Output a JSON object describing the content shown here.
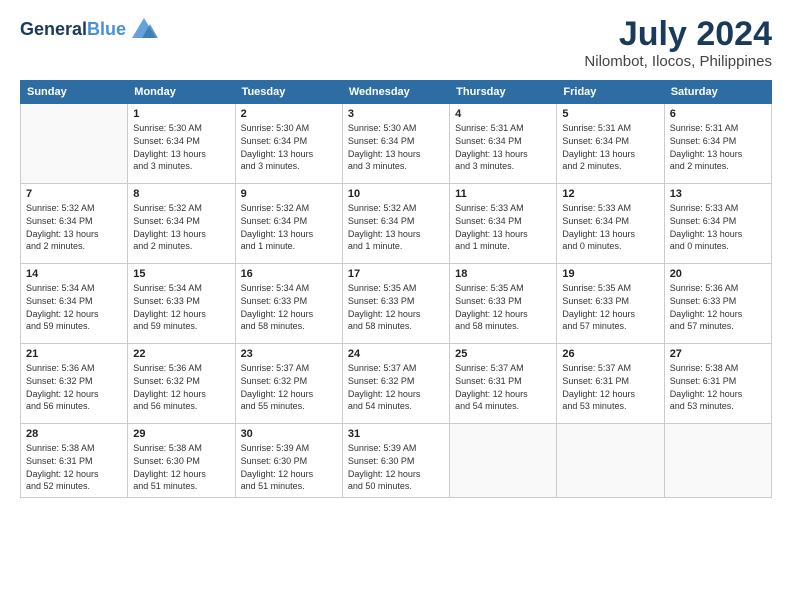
{
  "header": {
    "logo_line1": "General",
    "logo_line2": "Blue",
    "month_year": "July 2024",
    "location": "Nilombot, Ilocos, Philippines"
  },
  "weekdays": [
    "Sunday",
    "Monday",
    "Tuesday",
    "Wednesday",
    "Thursday",
    "Friday",
    "Saturday"
  ],
  "weeks": [
    [
      {
        "day": "",
        "info": ""
      },
      {
        "day": "1",
        "info": "Sunrise: 5:30 AM\nSunset: 6:34 PM\nDaylight: 13 hours\nand 3 minutes."
      },
      {
        "day": "2",
        "info": "Sunrise: 5:30 AM\nSunset: 6:34 PM\nDaylight: 13 hours\nand 3 minutes."
      },
      {
        "day": "3",
        "info": "Sunrise: 5:30 AM\nSunset: 6:34 PM\nDaylight: 13 hours\nand 3 minutes."
      },
      {
        "day": "4",
        "info": "Sunrise: 5:31 AM\nSunset: 6:34 PM\nDaylight: 13 hours\nand 3 minutes."
      },
      {
        "day": "5",
        "info": "Sunrise: 5:31 AM\nSunset: 6:34 PM\nDaylight: 13 hours\nand 2 minutes."
      },
      {
        "day": "6",
        "info": "Sunrise: 5:31 AM\nSunset: 6:34 PM\nDaylight: 13 hours\nand 2 minutes."
      }
    ],
    [
      {
        "day": "7",
        "info": "Sunrise: 5:32 AM\nSunset: 6:34 PM\nDaylight: 13 hours\nand 2 minutes."
      },
      {
        "day": "8",
        "info": "Sunrise: 5:32 AM\nSunset: 6:34 PM\nDaylight: 13 hours\nand 2 minutes."
      },
      {
        "day": "9",
        "info": "Sunrise: 5:32 AM\nSunset: 6:34 PM\nDaylight: 13 hours\nand 1 minute."
      },
      {
        "day": "10",
        "info": "Sunrise: 5:32 AM\nSunset: 6:34 PM\nDaylight: 13 hours\nand 1 minute."
      },
      {
        "day": "11",
        "info": "Sunrise: 5:33 AM\nSunset: 6:34 PM\nDaylight: 13 hours\nand 1 minute."
      },
      {
        "day": "12",
        "info": "Sunrise: 5:33 AM\nSunset: 6:34 PM\nDaylight: 13 hours\nand 0 minutes."
      },
      {
        "day": "13",
        "info": "Sunrise: 5:33 AM\nSunset: 6:34 PM\nDaylight: 13 hours\nand 0 minutes."
      }
    ],
    [
      {
        "day": "14",
        "info": "Sunrise: 5:34 AM\nSunset: 6:34 PM\nDaylight: 12 hours\nand 59 minutes."
      },
      {
        "day": "15",
        "info": "Sunrise: 5:34 AM\nSunset: 6:33 PM\nDaylight: 12 hours\nand 59 minutes."
      },
      {
        "day": "16",
        "info": "Sunrise: 5:34 AM\nSunset: 6:33 PM\nDaylight: 12 hours\nand 58 minutes."
      },
      {
        "day": "17",
        "info": "Sunrise: 5:35 AM\nSunset: 6:33 PM\nDaylight: 12 hours\nand 58 minutes."
      },
      {
        "day": "18",
        "info": "Sunrise: 5:35 AM\nSunset: 6:33 PM\nDaylight: 12 hours\nand 58 minutes."
      },
      {
        "day": "19",
        "info": "Sunrise: 5:35 AM\nSunset: 6:33 PM\nDaylight: 12 hours\nand 57 minutes."
      },
      {
        "day": "20",
        "info": "Sunrise: 5:36 AM\nSunset: 6:33 PM\nDaylight: 12 hours\nand 57 minutes."
      }
    ],
    [
      {
        "day": "21",
        "info": "Sunrise: 5:36 AM\nSunset: 6:32 PM\nDaylight: 12 hours\nand 56 minutes."
      },
      {
        "day": "22",
        "info": "Sunrise: 5:36 AM\nSunset: 6:32 PM\nDaylight: 12 hours\nand 56 minutes."
      },
      {
        "day": "23",
        "info": "Sunrise: 5:37 AM\nSunset: 6:32 PM\nDaylight: 12 hours\nand 55 minutes."
      },
      {
        "day": "24",
        "info": "Sunrise: 5:37 AM\nSunset: 6:32 PM\nDaylight: 12 hours\nand 54 minutes."
      },
      {
        "day": "25",
        "info": "Sunrise: 5:37 AM\nSunset: 6:31 PM\nDaylight: 12 hours\nand 54 minutes."
      },
      {
        "day": "26",
        "info": "Sunrise: 5:37 AM\nSunset: 6:31 PM\nDaylight: 12 hours\nand 53 minutes."
      },
      {
        "day": "27",
        "info": "Sunrise: 5:38 AM\nSunset: 6:31 PM\nDaylight: 12 hours\nand 53 minutes."
      }
    ],
    [
      {
        "day": "28",
        "info": "Sunrise: 5:38 AM\nSunset: 6:31 PM\nDaylight: 12 hours\nand 52 minutes."
      },
      {
        "day": "29",
        "info": "Sunrise: 5:38 AM\nSunset: 6:30 PM\nDaylight: 12 hours\nand 51 minutes."
      },
      {
        "day": "30",
        "info": "Sunrise: 5:39 AM\nSunset: 6:30 PM\nDaylight: 12 hours\nand 51 minutes."
      },
      {
        "day": "31",
        "info": "Sunrise: 5:39 AM\nSunset: 6:30 PM\nDaylight: 12 hours\nand 50 minutes."
      },
      {
        "day": "",
        "info": ""
      },
      {
        "day": "",
        "info": ""
      },
      {
        "day": "",
        "info": ""
      }
    ]
  ]
}
